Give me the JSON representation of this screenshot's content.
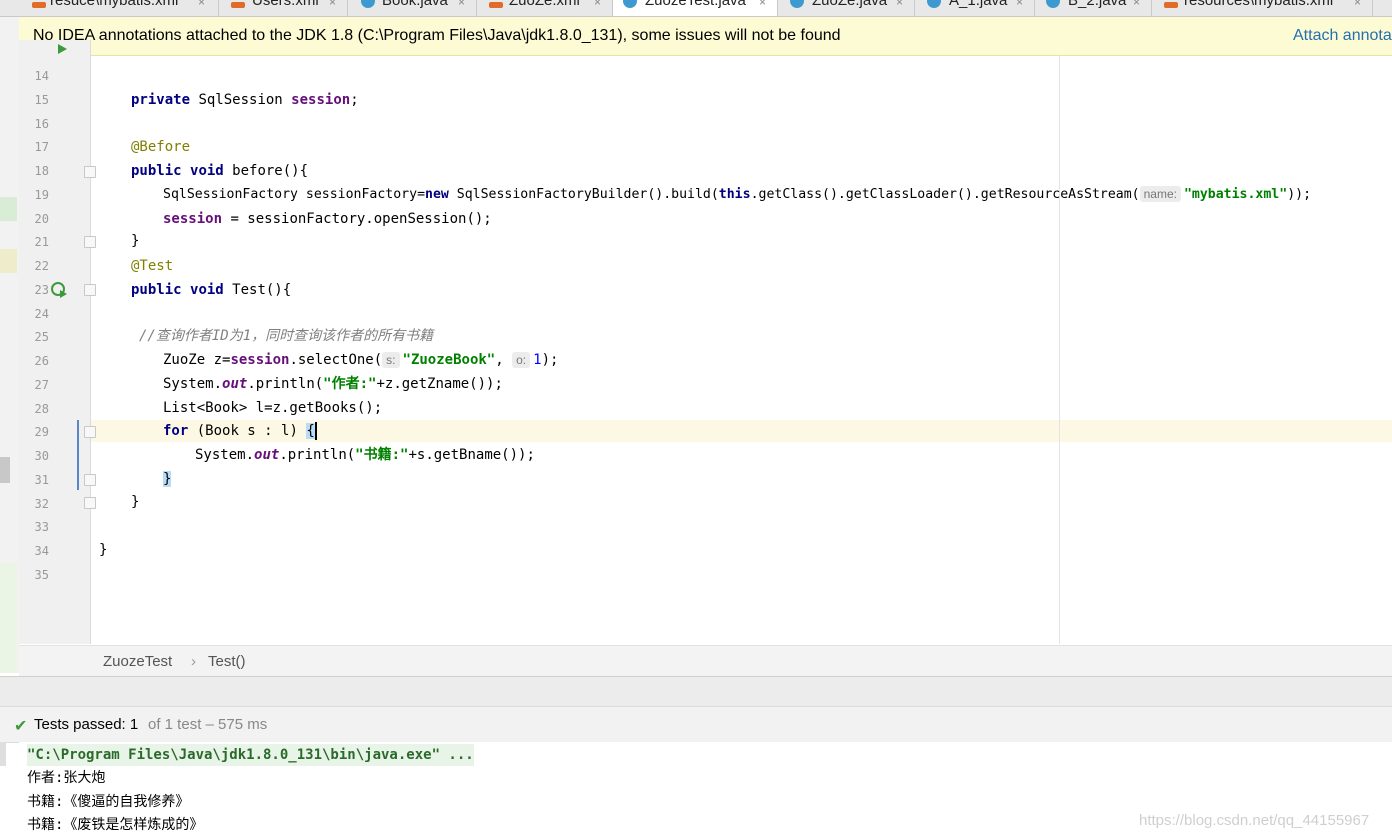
{
  "tabs": [
    {
      "label": "resuce\\mybatis.xml",
      "type": "xml",
      "active": false
    },
    {
      "label": "Users.xml",
      "type": "xml",
      "active": false
    },
    {
      "label": "Book.java",
      "type": "class",
      "active": false
    },
    {
      "label": "ZuoZe.xml",
      "type": "xml",
      "active": false
    },
    {
      "label": "ZuozeTest.java",
      "type": "class",
      "active": true
    },
    {
      "label": "ZuoZe.java",
      "type": "class",
      "active": false
    },
    {
      "label": "A_1.java",
      "type": "class",
      "active": false
    },
    {
      "label": "B_2.java",
      "type": "class",
      "active": false
    },
    {
      "label": "resources\\mybatis.xml",
      "type": "xml",
      "active": false
    }
  ],
  "tab_close_glyph": "×",
  "notification": {
    "message": "No IDEA annotations attached to the JDK 1.8 (C:\\Program Files\\Java\\jdk1.8.0_131), some issues will not be found",
    "action": "Attach annota"
  },
  "line_numbers": [
    "14",
    "15",
    "16",
    "17",
    "18",
    "19",
    "20",
    "21",
    "22",
    "23",
    "24",
    "25",
    "26",
    "27",
    "28",
    "29",
    "30",
    "31",
    "32",
    "33",
    "34",
    "35"
  ],
  "code": {
    "l15_kw": "private",
    "l15_type": " SqlSession ",
    "l15_fld": "session",
    "l15_end": ";",
    "l17_ann": "@Before",
    "l18_kw1": "public",
    "l18_kw2": "void",
    "l18_rest": " before(){",
    "l19_a": "SqlSessionFactory sessionFactory=",
    "l19_new": "new",
    "l19_b": " SqlSessionFactoryBuilder().build(",
    "l19_this": "this",
    "l19_c": ".getClass().getClassLoader().getResourceAsStream(",
    "l19_hint": "name:",
    "l19_str": "\"mybatis.xml\"",
    "l19_end": "));",
    "l20_fld": "session",
    "l20_rest": " = sessionFactory.openSession();",
    "l21": "}",
    "l22_ann": "@Test",
    "l23_kw1": "public",
    "l23_kw2": "void",
    "l23_rest": " Test(){",
    "l25_cmt": "//查询作者ID为1，同时查询该作者的所有书籍",
    "l26_a": "ZuoZe z=",
    "l26_fld": "session",
    "l26_b": ".selectOne(",
    "l26_hint1": "s:",
    "l26_str": "\"ZuozeBook\"",
    "l26_c": ",",
    "l26_hint2": "o:",
    "l26_num": "1",
    "l26_end": ");",
    "l27_a": "System.",
    "l27_out": "out",
    "l27_b": ".println(",
    "l27_str": "\"作者:\"",
    "l27_end": "+z.getZname());",
    "l28": "List<Book> l=z.getBooks();",
    "l29_kw": "for",
    "l29_rest": " (Book s : l) ",
    "l29_brace": "{",
    "l30_a": "System.",
    "l30_out": "out",
    "l30_b": ".println(",
    "l30_str": "\"书籍:\"",
    "l30_end": "+s.getBname());",
    "l31": "}",
    "l32": "}",
    "l34": "}"
  },
  "breadcrumb": {
    "cls": "ZuozeTest",
    "sep": "›",
    "method": "Test()"
  },
  "run": {
    "status": "Tests passed: 1",
    "detail": "of 1 test – 575 ms",
    "cmd": "\"C:\\Program Files\\Java\\jdk1.8.0_131\\bin\\java.exe\" ...",
    "out1": "作者:张大炮",
    "out2": "书籍:《傻逼的自我修养》",
    "out3": "书籍:《废铁是怎样炼成的》"
  },
  "watermark": "https://blog.csdn.net/qq_44155967",
  "colors": {
    "keyword": "#000080",
    "field": "#660e7a",
    "string": "#008000",
    "annotation": "#808000",
    "comment": "#808080",
    "notification_bg": "#fdfbd3",
    "link": "#2470b3",
    "pass": "#3c9a3c"
  }
}
